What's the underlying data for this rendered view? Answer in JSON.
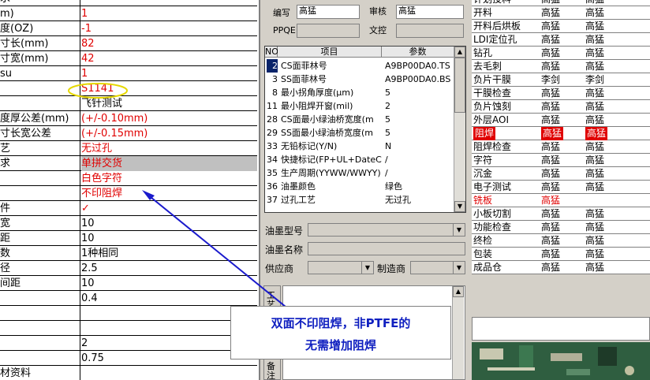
{
  "left_table": {
    "rows": [
      {
        "label": "求",
        "value": "",
        "red": false
      },
      {
        "label": "m)",
        "value": "1",
        "red": true
      },
      {
        "label": "度(OZ)",
        "value": "-1",
        "red": true
      },
      {
        "label": "寸长(mm)",
        "value": "82",
        "red": true
      },
      {
        "label": "寸宽(mm)",
        "value": "42",
        "red": true
      },
      {
        "label": "su",
        "value": "1",
        "red": true
      },
      {
        "label": "",
        "value": "S1141",
        "red": true,
        "ellipse": true
      },
      {
        "label": "",
        "value": "飞针测试",
        "red": false
      },
      {
        "label": "度厚公差(mm)",
        "value": "(+/-0.10mm)",
        "red": true
      },
      {
        "label": "寸长宽公差",
        "value": "(+/-0.15mm)",
        "red": true
      },
      {
        "label": "艺",
        "value": "无过孔",
        "red": true
      },
      {
        "label": "求",
        "value": "单拼交货",
        "red": true,
        "highlight": true
      },
      {
        "label": "",
        "value": "白色字符",
        "red": true
      },
      {
        "label": "",
        "value": "不印阻焊",
        "red": true
      },
      {
        "label": "件",
        "value": "✓",
        "red": true
      },
      {
        "label": "宽",
        "value": "10",
        "red": false
      },
      {
        "label": "距",
        "value": "10",
        "red": false
      },
      {
        "label": "数",
        "value": "1种相同",
        "red": false
      },
      {
        "label": "径",
        "value": "2.5",
        "red": false
      },
      {
        "label": "间距",
        "value": "10",
        "red": false
      },
      {
        "label": "",
        "value": "0.4",
        "red": false
      },
      {
        "label": "",
        "value": "",
        "red": false
      },
      {
        "label": "",
        "value": "",
        "red": false
      },
      {
        "label": "",
        "value": "2",
        "red": false
      },
      {
        "label": "",
        "value": "0.75",
        "red": false
      },
      {
        "label": "材资料",
        "value": "",
        "red": false
      }
    ]
  },
  "header": {
    "bianxie_label": "编写",
    "bianxie_value": "高猛",
    "shenhe_label": "审核",
    "shenhe_value": "高猛",
    "ppqe_label": "PPQE",
    "wenkong_label": "文控"
  },
  "grid": {
    "col_no": "NO",
    "col_item": "项目",
    "col_param": "参数",
    "rows": [
      {
        "no": "2",
        "item": "CS面菲林号",
        "param": "A9BP00DA0.TS",
        "selected": true
      },
      {
        "no": "3",
        "item": "SS面菲林号",
        "param": "A9BP00DA0.BS"
      },
      {
        "no": "8",
        "item": "最小拐角厚度(μm)",
        "param": "5"
      },
      {
        "no": "11",
        "item": "最小阻焊开窗(mil)",
        "param": "2"
      },
      {
        "no": "28",
        "item": "CS面最小绿油桥宽度(m",
        "param": "5"
      },
      {
        "no": "29",
        "item": "SS面最小绿油桥宽度(m",
        "param": "5"
      },
      {
        "no": "33",
        "item": "无铅标记(Y/N)",
        "param": "N"
      },
      {
        "no": "34",
        "item": "快捷标记(FP+UL+DateCo",
        "param": "/"
      },
      {
        "no": "35",
        "item": "生产周期(YYWW/WWYY)",
        "param": "/"
      },
      {
        "no": "36",
        "item": "油墨颜色",
        "param": "绿色"
      },
      {
        "no": "37",
        "item": "过孔工艺",
        "param": "无过孔"
      }
    ]
  },
  "form": {
    "ink_model_label": "油墨型号",
    "ink_name_label": "油墨名称",
    "supplier_label": "供应商",
    "maker_label": "制造商",
    "side_tab_label": "工艺",
    "remark_label": "备注"
  },
  "right_table": {
    "rows": [
      {
        "step": "计划投料",
        "a": "高猛",
        "b": "高猛"
      },
      {
        "step": "开料",
        "a": "高猛",
        "b": "高猛"
      },
      {
        "step": "开料后烘板",
        "a": "高猛",
        "b": "高猛"
      },
      {
        "step": "LDI定位孔",
        "a": "高猛",
        "b": "高猛"
      },
      {
        "step": "钻孔",
        "a": "高猛",
        "b": "高猛"
      },
      {
        "step": "去毛刺",
        "a": "高猛",
        "b": "高猛"
      },
      {
        "step": "负片干膜",
        "a": "李剑",
        "b": "李剑"
      },
      {
        "step": "干膜检查",
        "a": "高猛",
        "b": "高猛"
      },
      {
        "step": "负片蚀刻",
        "a": "高猛",
        "b": "高猛"
      },
      {
        "step": "外层AOI",
        "a": "高猛",
        "b": "高猛"
      },
      {
        "step": "阻焊",
        "a": "高猛",
        "b": "高猛",
        "selected": true
      },
      {
        "step": "阻焊检查",
        "a": "高猛",
        "b": "高猛"
      },
      {
        "step": "字符",
        "a": "高猛",
        "b": "高猛"
      },
      {
        "step": "沉金",
        "a": "高猛",
        "b": "高猛"
      },
      {
        "step": "电子测试",
        "a": "高猛",
        "b": "高猛"
      },
      {
        "step": "铣板",
        "a": "高猛",
        "b": "",
        "red": true
      },
      {
        "step": "小板切割",
        "a": "高猛",
        "b": "高猛"
      },
      {
        "step": "功能检查",
        "a": "高猛",
        "b": "高猛"
      },
      {
        "step": "终检",
        "a": "高猛",
        "b": "高猛"
      },
      {
        "step": "包装",
        "a": "高猛",
        "b": "高猛"
      },
      {
        "step": "成品仓",
        "a": "高猛",
        "b": "高猛"
      }
    ]
  },
  "callout": {
    "line1": "双面不印阻焊，非PTFE的",
    "line2": "无需增加阻焊"
  },
  "colors": {
    "accent_red": "#e00000",
    "callout_text": "#1020c0",
    "arrow": "#1a1acc"
  }
}
